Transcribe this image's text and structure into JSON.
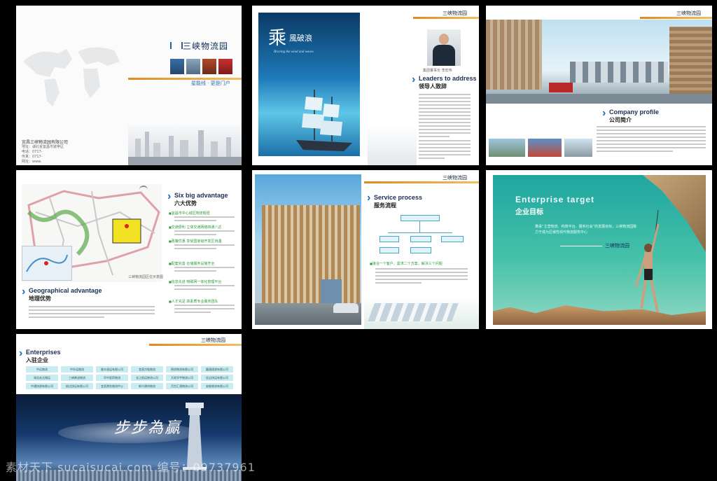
{
  "colors": {
    "background": "#000000",
    "accent_blue": "#1a6fb8",
    "accent_orange": "#e08a1e",
    "accent_green": "#2a9a3a",
    "teal": "#2fb7a6"
  },
  "logo_text": "三峡物流园",
  "cover": {
    "slogan": "星能线 · 更是门户",
    "company_name": "宜昌三峡物流园有限公司",
    "address_lines": [
      "地址：湖北省宜昌市猇亭区",
      "电话：0717-",
      "传真：0717-",
      "网址：www."
    ]
  },
  "p2": {
    "calligraphy_big": "乘",
    "calligraphy_rest": "風破浪",
    "italic_caption": "Braving the wind and waves",
    "leaders_en": "Leaders to address",
    "leaders_cn": "领导人致辞",
    "chairman_label": "集团董事长 李宏伟"
  },
  "p3": {
    "profile_en": "Company profile",
    "profile_cn": "公司简介"
  },
  "p4": {
    "six_en": "Six big advantage",
    "six_cn": "六大优势",
    "geo_en": "Geographical advantage",
    "geo_cn": "地理优势",
    "bullets": [
      "宜昌市中心城区物流枢纽",
      "交通便利 立体交通网络四通八达",
      "政策优惠 享受国家级开发区待遇",
      "配套完善 仓储服务设施齐全",
      "信息先进 物联网一体化管理平台",
      "人才充足 高素质专业服务团队"
    ],
    "map_caption": "三峡物流园区位示意图"
  },
  "p5": {
    "service_en": "Service process",
    "service_cn": "服务流程",
    "flow": [
      "客户",
      "仓储",
      "配送",
      "运输",
      "信息中心"
    ],
    "steps": [
      "接洽一个客户，需求二个方案，解决三个问题"
    ]
  },
  "p6": {
    "target_en": "Enterprise target",
    "target_cn": "企业目标",
    "body": "秉承“主营物流、构筑平台、服务社会”的发展目标，三峡物流园致力于成为区域性现代物流服务中心"
  },
  "p7": {
    "ent_en": "Enterprises",
    "ent_cn": "入驻企业",
    "calligraphy": "步步為贏",
    "table": [
      [
        "中远物流",
        "中外运物流",
        "顺丰速运有限公司",
        "宜昌冷链物流",
        "德邦物流有限公司",
        "圆通速递有限公司"
      ],
      [
        "湖北宏达储运",
        "三峡粮油物流",
        "华中医药物流",
        "长江航运物流公司",
        "天地华宇物流公司",
        "佳吉快运有限公司"
      ],
      [
        "中通快递有限公司",
        "韵达快运有限公司",
        "宜昌港务物流中心",
        "新兴建材物流",
        "百世汇通物流公司",
        "安能物流有限公司"
      ]
    ]
  },
  "watermark": "素材天下 sucaisucai.com  编号：09737961"
}
